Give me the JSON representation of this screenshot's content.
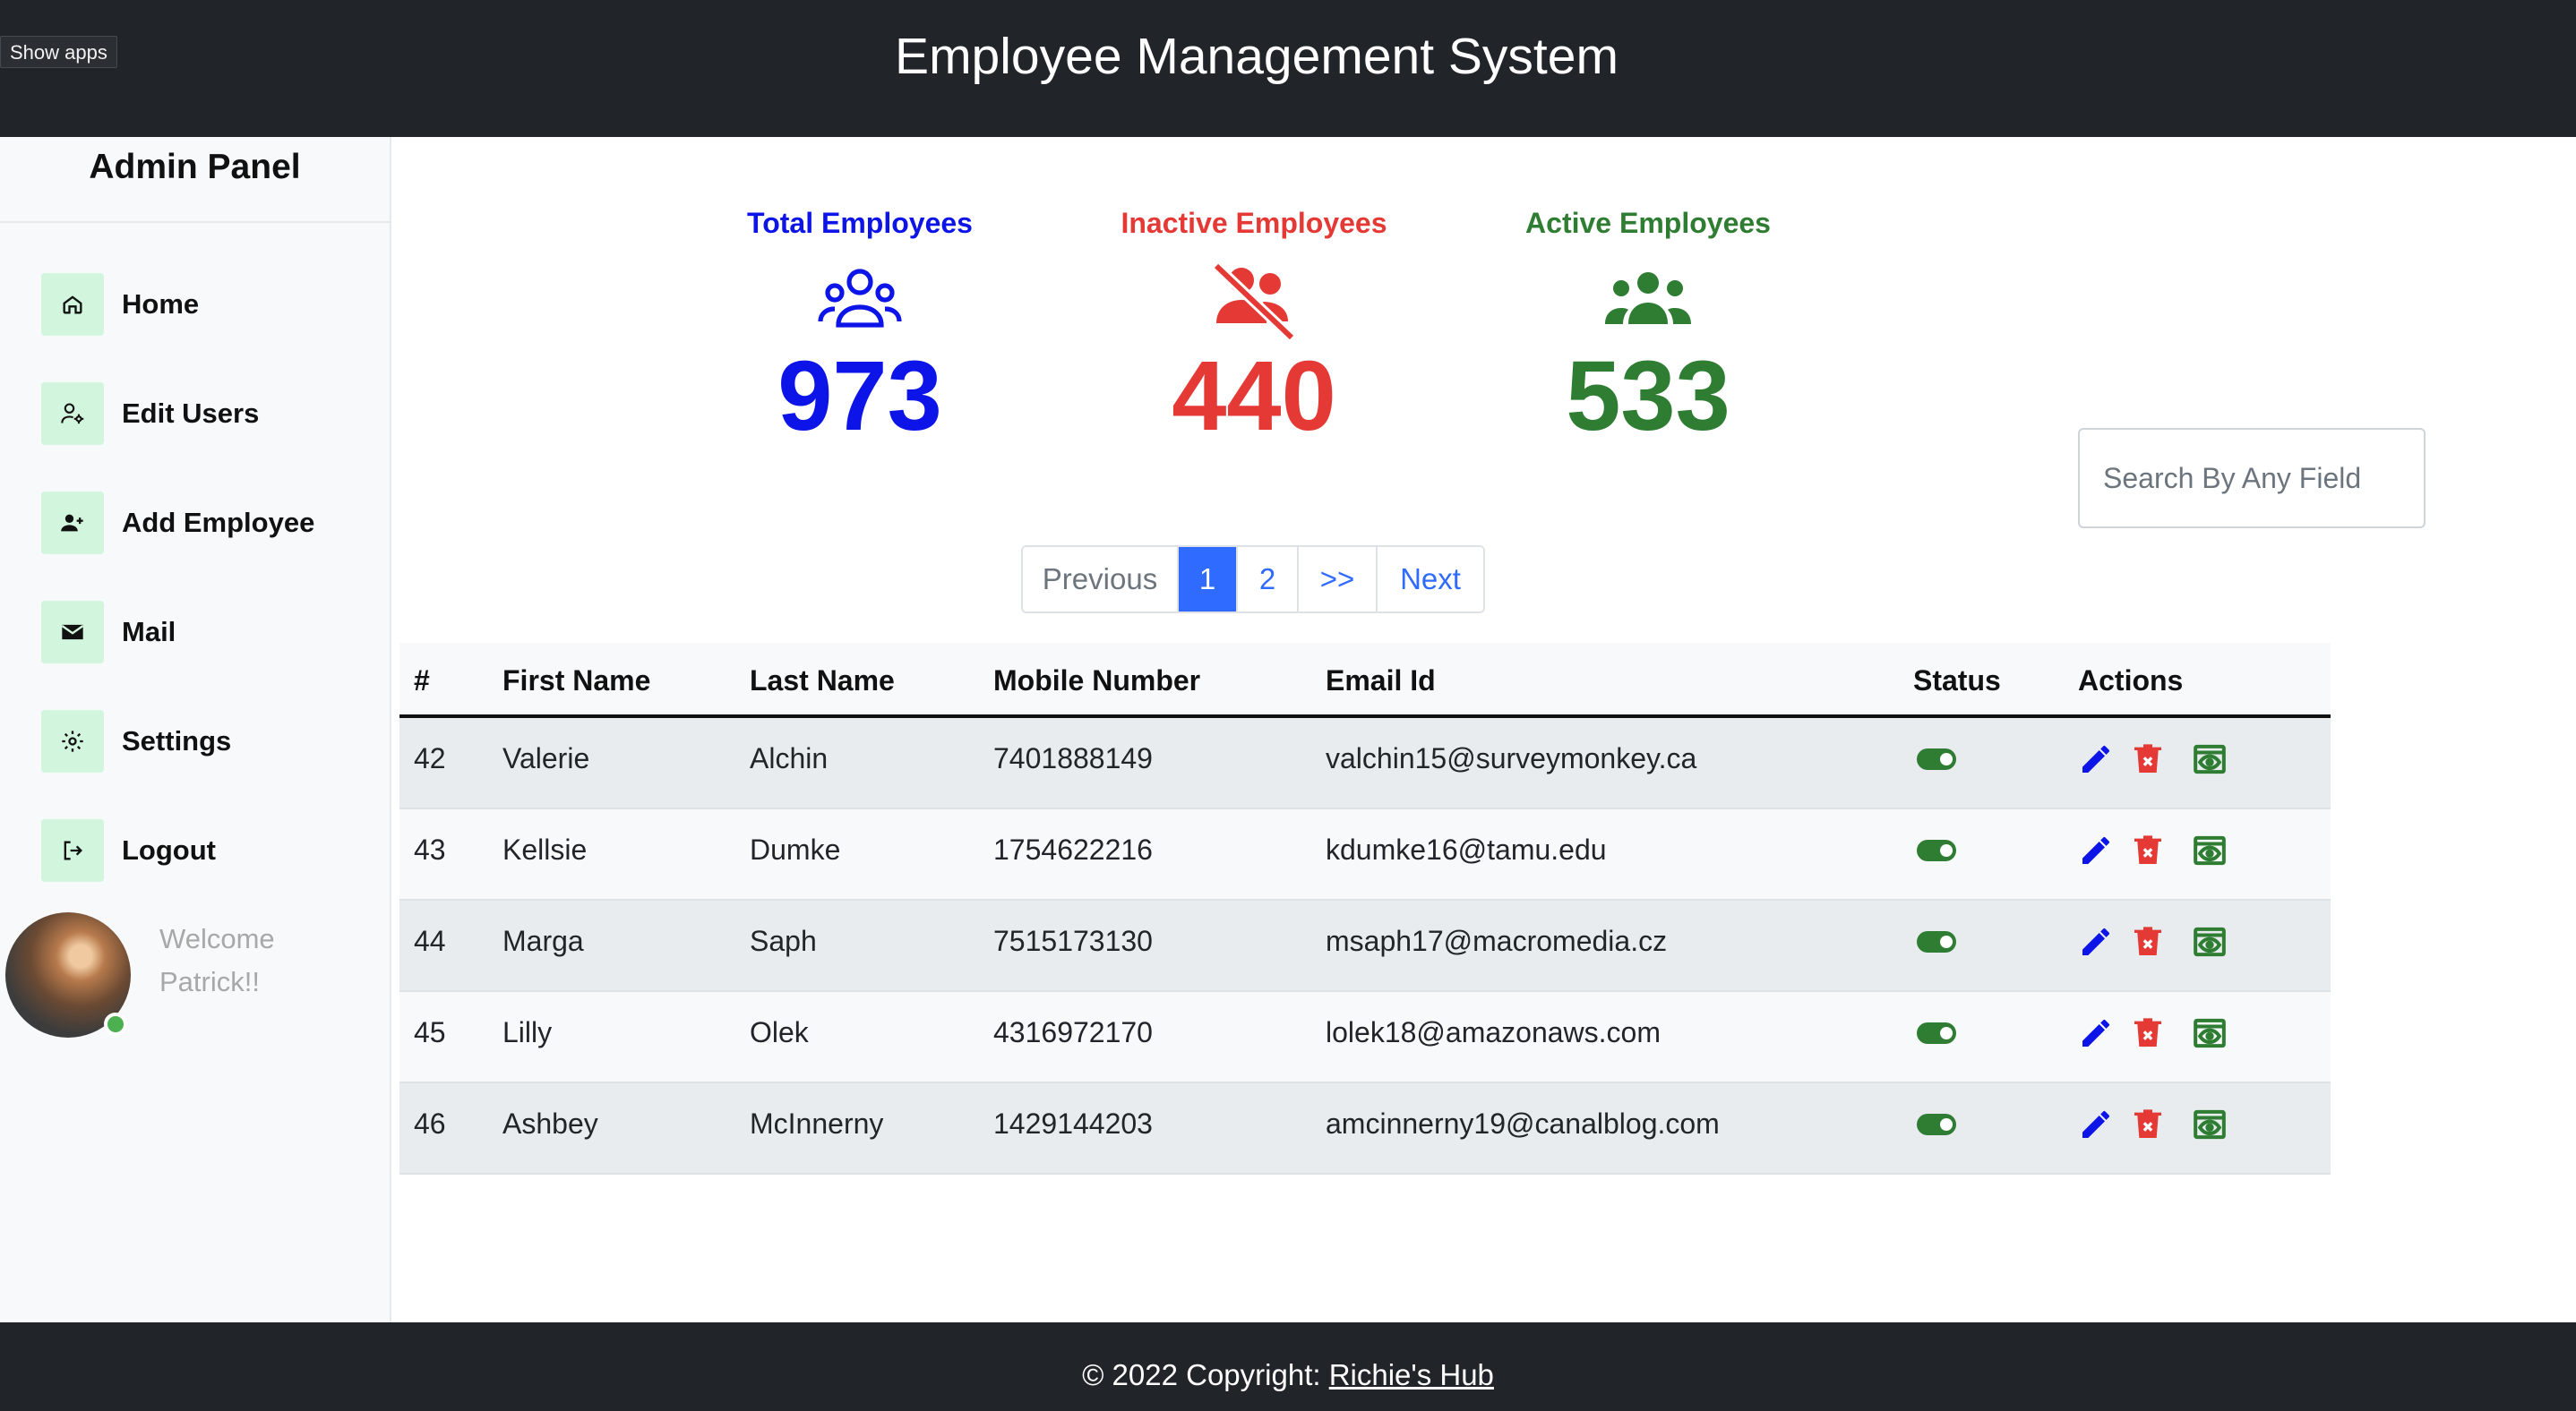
{
  "header": {
    "title": "Employee Management System",
    "show_apps": "Show apps"
  },
  "sidebar": {
    "heading": "Admin Panel",
    "items": [
      {
        "label": "Home",
        "icon": "home-icon"
      },
      {
        "label": "Edit Users",
        "icon": "user-gear-icon"
      },
      {
        "label": "Add Employee",
        "icon": "user-plus-icon"
      },
      {
        "label": "Mail",
        "icon": "mail-icon"
      },
      {
        "label": "Settings",
        "icon": "gear-icon"
      },
      {
        "label": "Logout",
        "icon": "logout-icon"
      }
    ],
    "user": {
      "welcome_line1": "Welcome",
      "welcome_line2": "Patrick!!",
      "status": "online"
    }
  },
  "stats": [
    {
      "title": "Total Employees",
      "value": "973",
      "color": "#0c14e8",
      "icon": "users-outline-icon"
    },
    {
      "title": "Inactive Employees",
      "value": "440",
      "color": "#e53935",
      "icon": "users-slash-icon"
    },
    {
      "title": "Active Employees",
      "value": "533",
      "color": "#2e7d32",
      "icon": "users-icon"
    }
  ],
  "search": {
    "placeholder": "Search By Any Field",
    "value": ""
  },
  "pagination": {
    "previous": "Previous",
    "pages": [
      "1",
      "2"
    ],
    "jump": ">>",
    "next": "Next",
    "current": "1"
  },
  "table": {
    "headers": [
      "#",
      "First Name",
      "Last Name",
      "Mobile Number",
      "Email Id",
      "Status",
      "Actions"
    ],
    "rows": [
      {
        "id": "42",
        "first": "Valerie",
        "last": "Alchin",
        "mobile": "7401888149",
        "email": "valchin15@surveymonkey.ca",
        "active": true
      },
      {
        "id": "43",
        "first": "Kellsie",
        "last": "Dumke",
        "mobile": "1754622216",
        "email": "kdumke16@tamu.edu",
        "active": true
      },
      {
        "id": "44",
        "first": "Marga",
        "last": "Saph",
        "mobile": "7515173130",
        "email": "msaph17@macromedia.cz",
        "active": true
      },
      {
        "id": "45",
        "first": "Lilly",
        "last": "Olek",
        "mobile": "4316972170",
        "email": "lolek18@amazonaws.com",
        "active": true
      },
      {
        "id": "46",
        "first": "Ashbey",
        "last": "McInnerny",
        "mobile": "1429144203",
        "email": "amcinnerny19@canalblog.com",
        "active": true
      }
    ],
    "action_icons": [
      "edit-icon",
      "delete-icon",
      "view-icon"
    ],
    "action_colors": {
      "edit": "#0c14e8",
      "delete": "#e53935",
      "view": "#2e7d32"
    }
  },
  "footer": {
    "copyright": "© 2022 Copyright: ",
    "link": "Richie's Hub"
  }
}
